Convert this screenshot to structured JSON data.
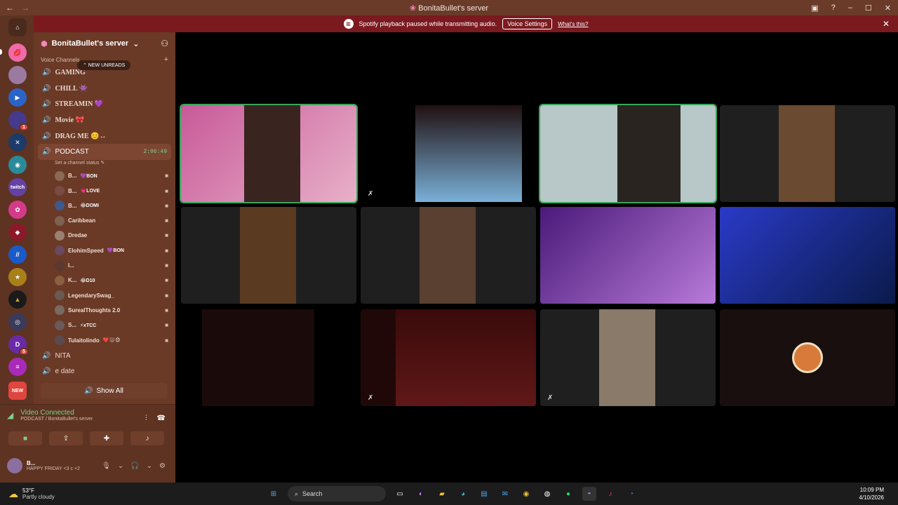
{
  "window": {
    "title": "BonitaBullet's server",
    "back": "←",
    "forward": "→",
    "inbox_icon": "inbox-icon",
    "help": "?",
    "min": "–",
    "max": "☐",
    "close": "✕"
  },
  "banner": {
    "message": "Spotify playback paused while transmitting audio.",
    "button": "Voice Settings",
    "link": "What's this?",
    "close": "✕"
  },
  "guilds": {
    "badges": [
      "1",
      "5"
    ],
    "twitch_label": "twitch",
    "new_label": "NEW"
  },
  "server": {
    "name": "BonitaBullet's server",
    "category": "Voice Channels",
    "new_unreads": "⌃ NEW UNREADS",
    "channels": [
      {
        "name": "GAMING"
      },
      {
        "name": "CHILL 👾"
      },
      {
        "name": "STREAMIN 💜"
      },
      {
        "name": "Movie 🎀"
      },
      {
        "name": "DRAG ME 😊↔"
      }
    ],
    "active_channel": {
      "name": "PODCAST",
      "timer": "2:06:49",
      "status": "Set a channel status ✎"
    },
    "members": [
      {
        "name": "B...",
        "tag": "💜BON",
        "color": "#8a6a55"
      },
      {
        "name": "B...",
        "tag": "💗LOVE",
        "color": "#7a4a45"
      },
      {
        "name": "B...",
        "tag": "😂DOMI",
        "color": "#3d5a8a"
      },
      {
        "name": "Caribbean",
        "tag": "",
        "color": "#7d6050"
      },
      {
        "name": "Dredae",
        "tag": "",
        "color": "#9a8070"
      },
      {
        "name": "ElohimSpeed",
        "tag": "💜BON",
        "color": "#6a4a60"
      },
      {
        "name": "I...",
        "tag": "",
        "color": "#5a3a30"
      },
      {
        "name": "K...",
        "tag": "😂D10",
        "color": "#8a6040"
      },
      {
        "name": "LegendarySwag_",
        "tag": "",
        "color": "#6a5a50"
      },
      {
        "name": "SurealThoughts 2.0",
        "tag": "",
        "color": "#7a6a60"
      },
      {
        "name": "S...",
        "tag": "⚡xTCC",
        "color": "#6a5a5a"
      },
      {
        "name": "TulaitoIindo",
        "tag": "❤️🐻😊",
        "color": "#5a4a50"
      }
    ],
    "other_channels": [
      "NITA",
      "e date"
    ],
    "show_all": "Show All"
  },
  "voice": {
    "status": "Video Connected",
    "location": "PODCAST / BonitaBullet's server"
  },
  "user": {
    "name": "B...",
    "status": "HAPPY FRIDAY <3 c +2"
  },
  "taskbar": {
    "temp": "53°F",
    "condition": "Partly cloudy",
    "search": "Search",
    "time": "10:09 PM",
    "date": "4/10/2026"
  },
  "colors": {
    "speaking": "#3ba55c",
    "sidebar": "#6a3a27",
    "banner": "#7a1a1f"
  }
}
